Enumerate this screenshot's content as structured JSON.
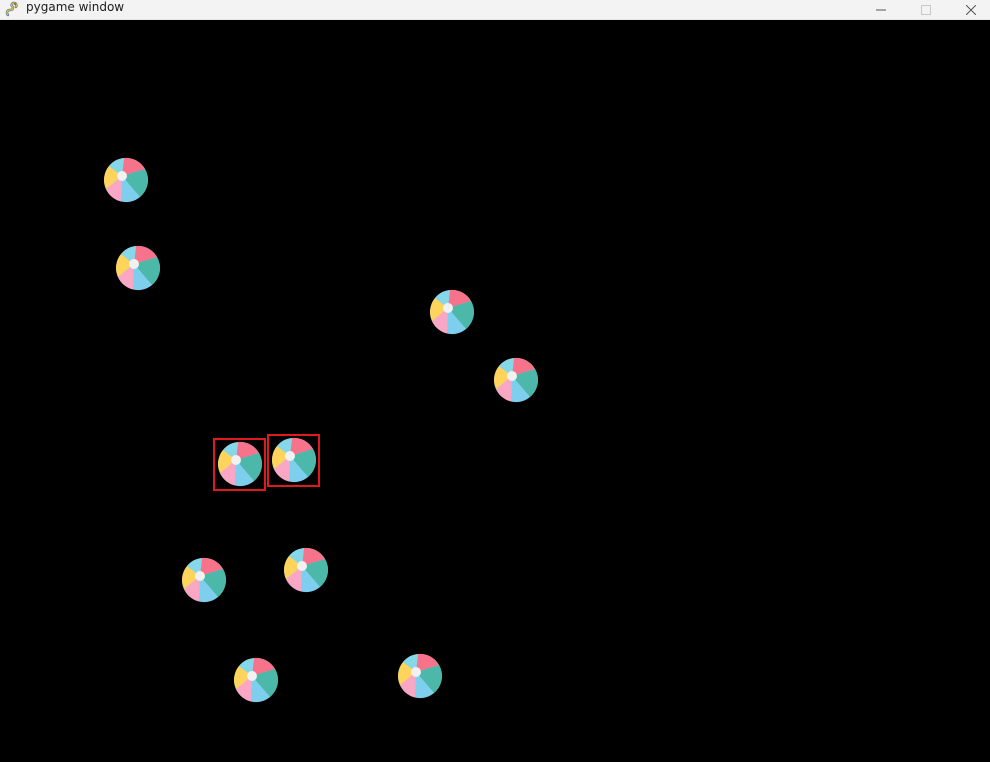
{
  "window": {
    "title": "pygame window",
    "icon": "pygame-snake-icon",
    "controls": [
      "minimize-icon",
      "maximize-icon",
      "close-icon"
    ]
  },
  "scene": {
    "background": "#000000",
    "sprite": "beach-ball-icon",
    "ball_count": 10,
    "selected_count": 2,
    "ball_colors": {
      "pink": "#f7738b",
      "teal": "#4cb8a9",
      "blue": "#7ecfee",
      "yellow": "#ffd45c",
      "lightpink": "#f9a7c4",
      "center": "#f1f1f1"
    },
    "highlight_color": "#e0191f"
  }
}
